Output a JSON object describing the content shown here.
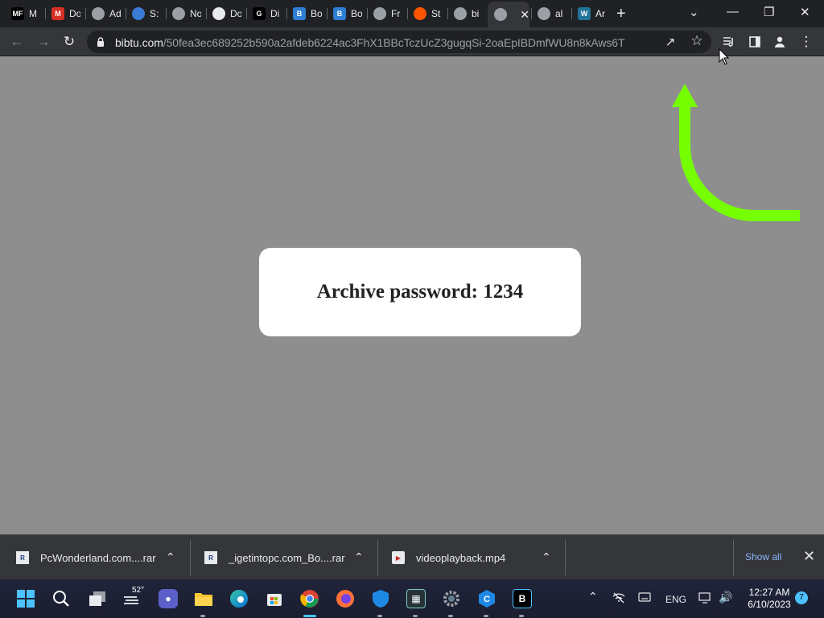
{
  "tabs": [
    {
      "icon_text": "MF",
      "icon_color": "#000000",
      "label": "M"
    },
    {
      "icon_text": "M",
      "icon_color": "#d93025",
      "label": "Do"
    },
    {
      "icon_text": "",
      "icon_color": "#9aa0a6",
      "label": "Ad"
    },
    {
      "icon_text": "",
      "icon_color": "#3a7bd5",
      "label": "S:"
    },
    {
      "icon_text": "",
      "icon_color": "#9aa0a6",
      "label": "No"
    },
    {
      "icon_text": "",
      "icon_color": "#e8eaed",
      "label": "Do"
    },
    {
      "icon_text": "G",
      "icon_color": "#000000",
      "label": "Di"
    },
    {
      "icon_text": "B",
      "icon_color": "#2d7fd3",
      "label": "Bo"
    },
    {
      "icon_text": "B",
      "icon_color": "#2d7fd3",
      "label": "Bo"
    },
    {
      "icon_text": "",
      "icon_color": "#9aa0a6",
      "label": "Fr"
    },
    {
      "icon_text": "",
      "icon_color": "#ff5500",
      "label": "St"
    },
    {
      "icon_text": "",
      "icon_color": "#9aa0a6",
      "label": "bi"
    },
    {
      "icon_text": "",
      "icon_color": "#9aa0a6",
      "label": "",
      "active": true
    },
    {
      "icon_text": "",
      "icon_color": "#9aa0a6",
      "label": "al"
    },
    {
      "icon_text": "W",
      "icon_color": "#21759b",
      "label": "Ar"
    }
  ],
  "address_bar": {
    "domain": "bibtu.com",
    "path": "/50fea3ec689252b590a2afdeb6224ac3FhX1BBcTczUcZ3gugqSi-2oaEpIBDmfWU8n8kAws6T"
  },
  "page": {
    "message": "Archive password: 1234",
    "arrow_color": "#76ff03",
    "background_color": "#8e8e8e"
  },
  "downloads": [
    {
      "filename": "PcWonderland.com....rar"
    },
    {
      "filename": "_igetintopc.com_Bo....rar"
    },
    {
      "filename": "videoplayback.mp4"
    }
  ],
  "download_bar": {
    "show_all": "Show all"
  },
  "taskbar": {
    "weather_temp": "52°",
    "language": "ENG",
    "time": "12:27 AM",
    "date": "6/10/2023",
    "notification_count": "7"
  }
}
